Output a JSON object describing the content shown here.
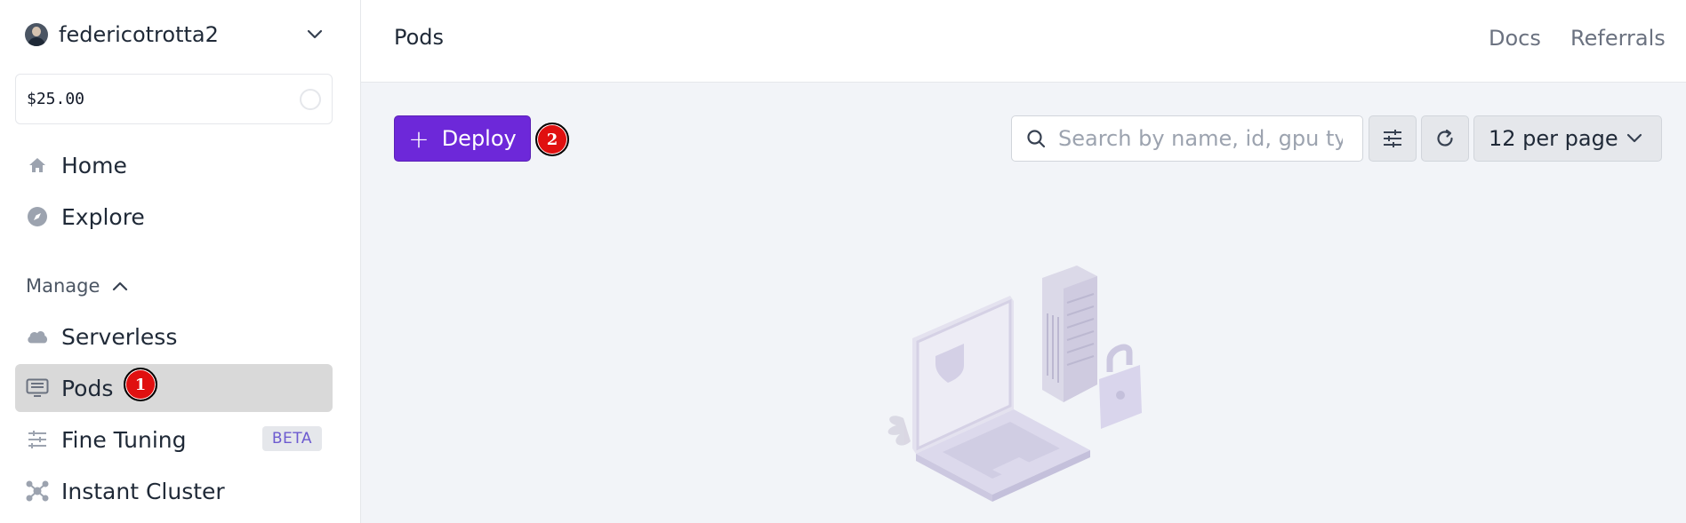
{
  "sidebar": {
    "account": {
      "name": "federicotrotta2"
    },
    "balance": {
      "value": "$25.00"
    },
    "top_items": [
      {
        "label": "Home",
        "icon": "home-icon"
      },
      {
        "label": "Explore",
        "icon": "compass-icon"
      }
    ],
    "section": {
      "label": "Manage"
    },
    "manage_items": [
      {
        "label": "Serverless",
        "icon": "cloud-icon"
      },
      {
        "label": "Pods",
        "icon": "pods-icon",
        "active": true
      },
      {
        "label": "Fine Tuning",
        "icon": "sliders-icon",
        "badge": "BETA"
      },
      {
        "label": "Instant Cluster",
        "icon": "cluster-icon"
      }
    ]
  },
  "header": {
    "title": "Pods",
    "links": [
      "Docs",
      "Referrals"
    ]
  },
  "toolbar": {
    "deploy_label": "Deploy",
    "search_placeholder": "Search by name, id, gpu type",
    "per_page_label": "12 per page"
  },
  "markers": [
    "1",
    "2"
  ],
  "colors": {
    "accent": "#6d28d9",
    "active_nav": "#d9d9d9",
    "main_bg": "#f2f4f8",
    "marker": "#e01010",
    "illustration": "#d4cfe8"
  }
}
